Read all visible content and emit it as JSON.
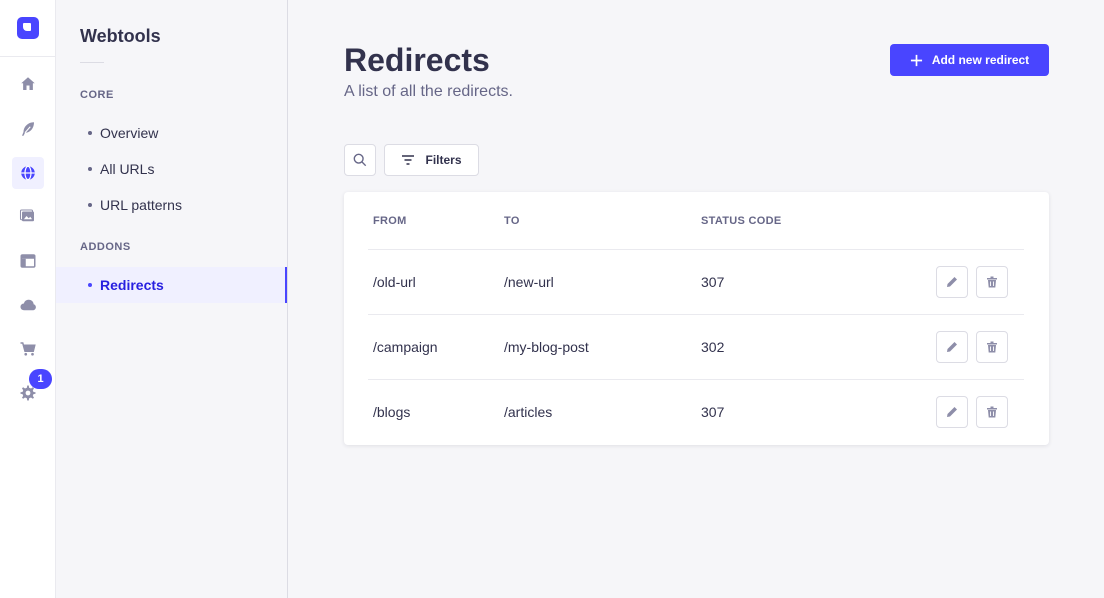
{
  "sidebar": {
    "title": "Webtools",
    "sections": [
      {
        "label": "CORE",
        "items": [
          "Overview",
          "All URLs",
          "URL patterns"
        ]
      },
      {
        "label": "ADDONS",
        "items": [
          "Redirects"
        ]
      }
    ],
    "active_item": "Redirects"
  },
  "rail": {
    "icons": [
      "home-icon",
      "feather-icon",
      "globe-icon",
      "media-icon",
      "layout-icon",
      "cloud-icon",
      "cart-icon",
      "gear-icon"
    ],
    "active_icon": "globe-icon",
    "settings_badge": "1"
  },
  "header": {
    "title": "Redirects",
    "subtitle": "A list of all the redirects.",
    "add_button_label": "Add new redirect"
  },
  "toolbar": {
    "filters_label": "Filters"
  },
  "table": {
    "columns": [
      "FROM",
      "TO",
      "STATUS CODE"
    ],
    "rows": [
      {
        "from": "/old-url",
        "to": "/new-url",
        "status": "307"
      },
      {
        "from": "/campaign",
        "to": "/my-blog-post",
        "status": "302"
      },
      {
        "from": "/blogs",
        "to": "/articles",
        "status": "307"
      }
    ]
  },
  "colors": {
    "primary": "#4945ff",
    "active_bg": "#f0f0ff",
    "active_text": "#271fe0",
    "text": "#32324d",
    "muted": "#666687"
  }
}
